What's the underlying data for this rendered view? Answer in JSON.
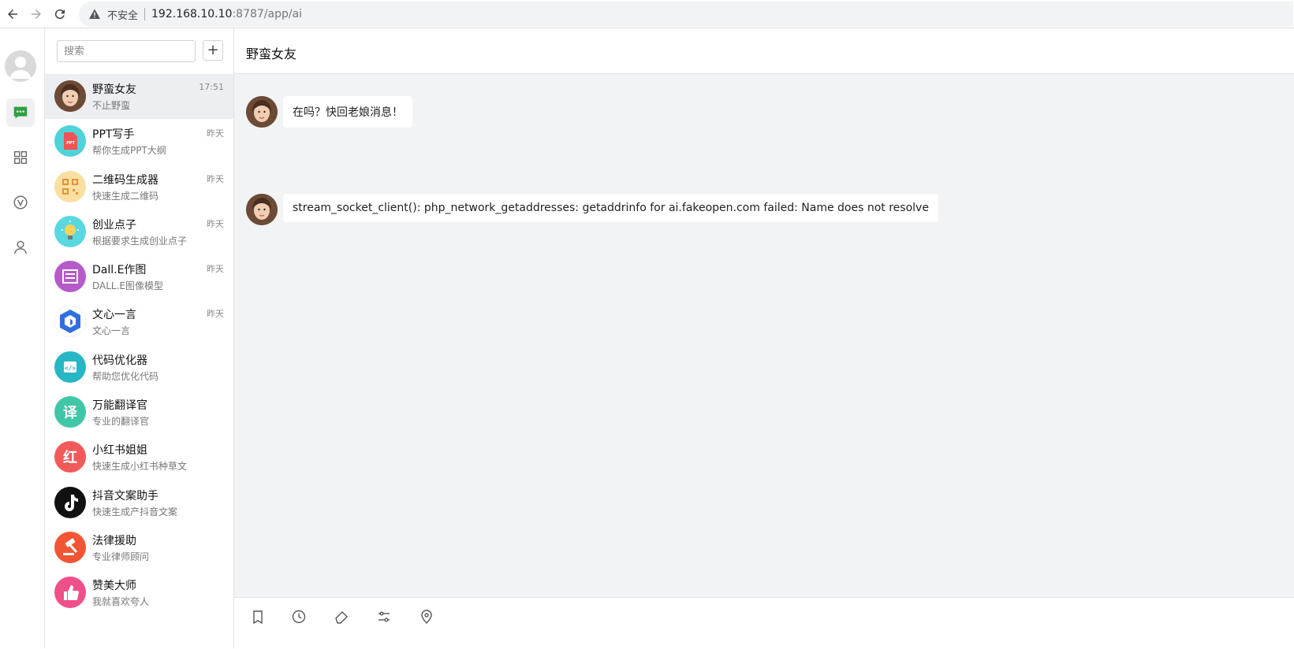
{
  "browser": {
    "security_label": "不安全",
    "url_host": "192.168.10.10",
    "url_path": ":8787/app/ai"
  },
  "rail": {
    "items": [
      {
        "name": "chat-icon",
        "active": true
      },
      {
        "name": "apps-grid-icon",
        "active": false
      },
      {
        "name": "vip-icon",
        "active": false
      },
      {
        "name": "user-icon",
        "active": false
      }
    ]
  },
  "list": {
    "search_placeholder": "搜索",
    "add_label": "+",
    "items": [
      {
        "title": "野蛮女友",
        "subtitle": "不止野蛮",
        "time": "17:51",
        "icon": "avatar-photo",
        "color": "#b98a6c"
      },
      {
        "title": "PPT写手",
        "subtitle": "帮你生成PPT大纲",
        "time": "昨天",
        "icon": "ppt-icon",
        "color": "#4dd3d8"
      },
      {
        "title": "二维码生成器",
        "subtitle": "快速生成二维码",
        "time": "昨天",
        "icon": "qrcode-icon",
        "color": "#f9e0a0"
      },
      {
        "title": "创业点子",
        "subtitle": "根据要求生成创业点子",
        "time": "昨天",
        "icon": "lightbulb-icon",
        "color": "#5ad8e0"
      },
      {
        "title": "Dall.E作图",
        "subtitle": "DALL.E图像模型",
        "time": "昨天",
        "icon": "painting-icon",
        "color": "#b45bc9"
      },
      {
        "title": "文心一言",
        "subtitle": "文心一言",
        "time": "昨天",
        "icon": "wenxin-logo-icon",
        "color": "#2f6fe0"
      },
      {
        "title": "代码优化器",
        "subtitle": "帮助您优化代码",
        "time": "",
        "icon": "code-icon",
        "color": "#27b7c4"
      },
      {
        "title": "万能翻译官",
        "subtitle": "专业的翻译官",
        "time": "",
        "icon": "translate-icon",
        "color": "#41c7a8",
        "glyph": "译"
      },
      {
        "title": "小红书姐姐",
        "subtitle": "快速生成小红书种草文",
        "time": "",
        "icon": "xiaohongshu-icon",
        "color": "#f25a5a",
        "glyph": "红"
      },
      {
        "title": "抖音文案助手",
        "subtitle": "快速生成产抖音文案",
        "time": "",
        "icon": "tiktok-icon",
        "color": "#111111"
      },
      {
        "title": "法律援助",
        "subtitle": "专业律师顾问",
        "time": "",
        "icon": "gavel-icon",
        "color": "#f25533"
      },
      {
        "title": "赞美大师",
        "subtitle": "我就喜欢夸人",
        "time": "",
        "icon": "thumbs-up-icon",
        "color": "#f0508a"
      }
    ]
  },
  "chat": {
    "title": "野蛮女友",
    "messages": [
      {
        "text": "在吗？快回老娘消息！"
      },
      {
        "text": "stream_socket_client(): php_network_getaddresses: getaddrinfo for ai.fakeopen.com failed: Name does not resolve"
      }
    ]
  }
}
